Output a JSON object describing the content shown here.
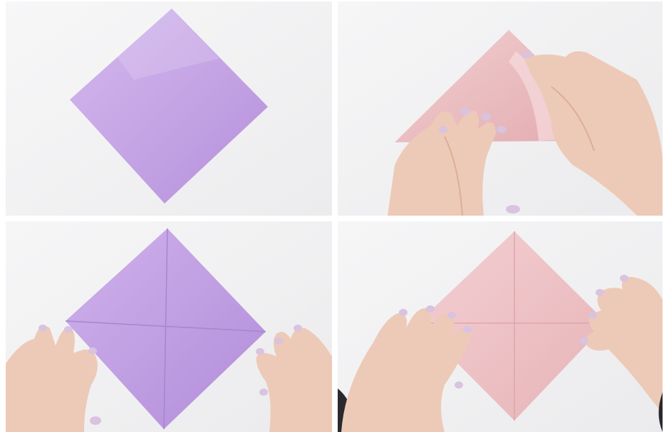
{
  "layout": "2x2 photo grid",
  "colors": {
    "background": "#f3f3f4",
    "purple_paper": "#c7a8e6",
    "purple_paper_shade": "#b894df",
    "pink_paper": "#efc3c6",
    "pink_paper_shade": "#e6b0b4",
    "skin": "#ecc9b6",
    "skin_shade": "#dcae98",
    "nail": "#d9c3df",
    "sleeve": "#2a2a2e"
  },
  "panels": [
    {
      "id": "step-1",
      "paper_color": "purple",
      "hands_visible": false
    },
    {
      "id": "step-2",
      "paper_color": "pink",
      "hands_visible": true
    },
    {
      "id": "step-3",
      "paper_color": "purple",
      "hands_visible": true
    },
    {
      "id": "step-4",
      "paper_color": "pink",
      "hands_visible": true
    }
  ]
}
